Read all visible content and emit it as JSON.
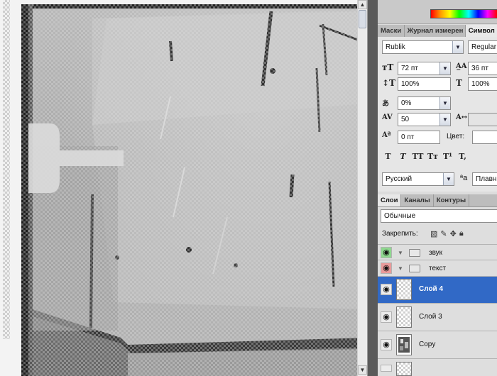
{
  "panel_tabs_top": [
    "Маски",
    "Журнал измерен",
    "Символ"
  ],
  "character": {
    "font_family": "Rublik",
    "font_style": "Regular",
    "font_size": "72 пт",
    "leading": "36 пт",
    "vertical_scale": "100%",
    "horizontal_scale": "100%",
    "tsume": "0%",
    "tracking": "50",
    "baseline_shift": "0 пт",
    "color_label": "Цвет:",
    "style_buttons": [
      "T",
      "T",
      "TT",
      "Tт",
      "T¹",
      "T,"
    ],
    "language": "Русский",
    "aa_glyph": "ªa",
    "antialias": "Плавн"
  },
  "layers_tabs": [
    "Слои",
    "Каналы",
    "Контуры"
  ],
  "layers": {
    "blend_mode": "Обычные",
    "lock_label": "Закрепить:",
    "items": [
      {
        "name": "звук",
        "type": "group",
        "eye_color": "#8fd88f"
      },
      {
        "name": "текст",
        "type": "group",
        "eye_color": "#e99a9a"
      },
      {
        "name": "Слой 4",
        "type": "layer",
        "selected": true
      },
      {
        "name": "Слой 3",
        "type": "layer"
      },
      {
        "name": "Copy",
        "type": "layer"
      }
    ]
  },
  "colors": {
    "selected_row": "#3169c6",
    "panel_bg": "#dcdcdc"
  }
}
